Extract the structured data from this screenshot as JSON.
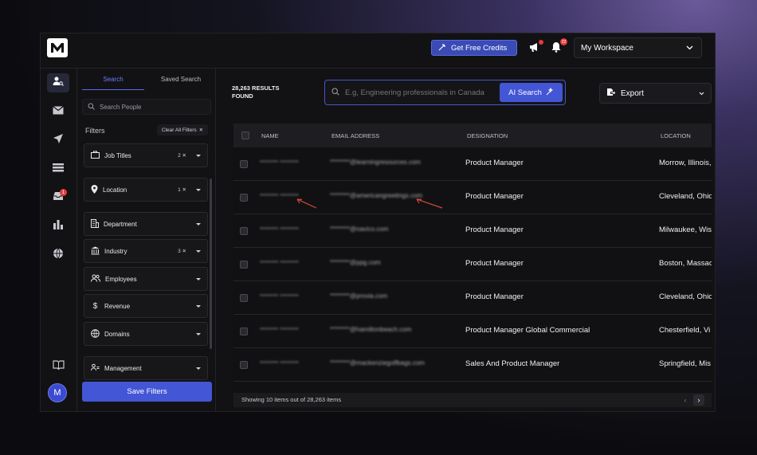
{
  "header": {
    "credits_label": "Get Free Credits",
    "notification_count": "22",
    "workspace_label": "My Workspace"
  },
  "rail": {
    "inbox_badge": "1",
    "avatar_initial": "M"
  },
  "panel": {
    "tab_search": "Search",
    "tab_saved": "Saved Search",
    "search_placeholder": "Search People",
    "filters_title": "Filters",
    "clear_filters": "Clear All Filters",
    "filters": [
      {
        "label": "Job Titles",
        "count": "2"
      },
      {
        "label": "Location",
        "count": "1"
      },
      {
        "label": "Department",
        "count": ""
      },
      {
        "label": "Industry",
        "count": "3"
      },
      {
        "label": "Employees",
        "count": ""
      },
      {
        "label": "Revenue",
        "count": ""
      },
      {
        "label": "Domains",
        "count": ""
      },
      {
        "label": "Management",
        "count": ""
      }
    ],
    "save_label": "Save Filters"
  },
  "main": {
    "results_count": "28,263 RESULTS",
    "results_suffix": "FOUND",
    "ai_placeholder": "E.g, Engineering professionals in Canada",
    "ai_button": "AI Search",
    "export_label": "Export"
  },
  "table": {
    "columns": [
      "NAME",
      "EMAIL ADDRESS",
      "DESIGNATION",
      "LOCATION"
    ],
    "rows": [
      {
        "name": "******** ********",
        "email": "********@learningresources.com",
        "designation": "Product Manager",
        "location": "Morrow, Illinois,"
      },
      {
        "name": "******** ********",
        "email": "********@americangreetings.com",
        "designation": "Product Manager",
        "location": "Cleveland, Ohio"
      },
      {
        "name": "******** ********",
        "email": "********@navico.com",
        "designation": "Product Manager",
        "location": "Milwaukee, Wis"
      },
      {
        "name": "******** ********",
        "email": "********@ppg.com",
        "designation": "Product Manager",
        "location": "Boston, Massac"
      },
      {
        "name": "******** ********",
        "email": "********@provia.com",
        "designation": "Product Manager",
        "location": "Cleveland, Ohio"
      },
      {
        "name": "******** ********",
        "email": "********@hamiltonbeach.com",
        "designation": "Product Manager Global Commercial",
        "location": "Chesterfield, Vi"
      },
      {
        "name": "******** ********",
        "email": "********@mackenziegolfbags.com",
        "designation": "Sales And Product Manager",
        "location": "Springfield, Mis"
      }
    ],
    "footer": "Showing 10 items out of 28,263 items"
  },
  "colors": {
    "accent": "#4356d6",
    "annotation": "#d04a3a"
  }
}
